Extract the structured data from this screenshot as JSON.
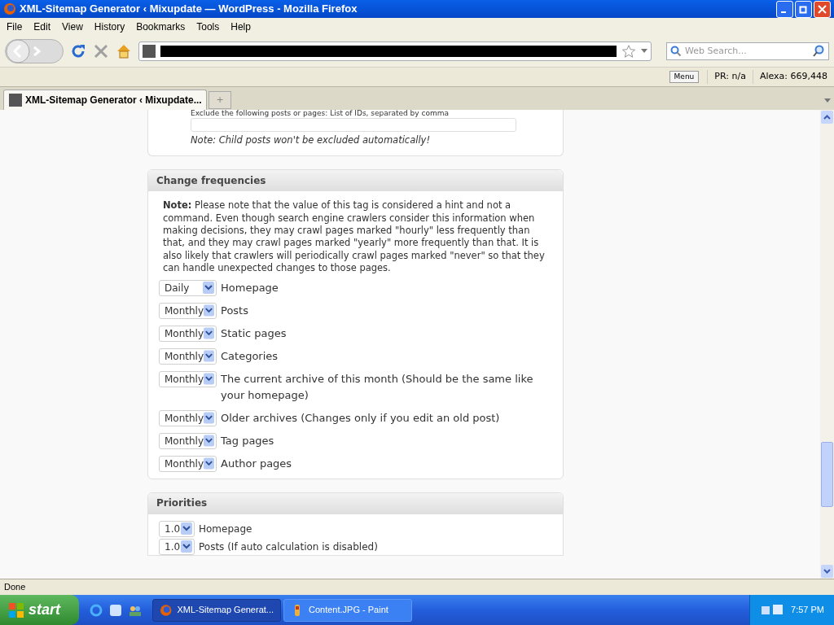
{
  "window": {
    "title": "XML-Sitemap Generator ‹ Mixupdate — WordPress - Mozilla Firefox"
  },
  "menu": [
    "File",
    "Edit",
    "View",
    "History",
    "Bookmarks",
    "Tools",
    "Help"
  ],
  "search": {
    "placeholder": "Web Search..."
  },
  "addon_bar": {
    "menu_button": "Menu",
    "pr": "PR: n/a",
    "alexa": "Alexa: 669,448"
  },
  "tabs": [
    {
      "label": "XML-Sitemap Generator ‹ Mixupdate...",
      "selected": true
    }
  ],
  "new_tab": "+",
  "exclude": {
    "label": "Exclude the following posts or pages: List of IDs, separated by comma",
    "note": "Note: Child posts won't be excluded automatically!"
  },
  "change_frequencies": {
    "title": "Change frequencies",
    "note": "**Note:** Please note that the value of this tag is considered a hint and not a command. Even though search engine crawlers consider this information when making decisions, they may crawl pages marked \"hourly\" less frequently than that, and they may crawl pages marked \"yearly\" more frequently than that. It is also likely that crawlers will periodically crawl pages marked \"never\" so that they can handle unexpected changes to those pages.",
    "rows": [
      {
        "value": "Daily",
        "label": "Homepage"
      },
      {
        "value": "Monthly",
        "label": "Posts"
      },
      {
        "value": "Monthly",
        "label": "Static pages"
      },
      {
        "value": "Monthly",
        "label": "Categories"
      },
      {
        "value": "Monthly",
        "label": "The current archive of this month (Should be the same like your homepage)"
      },
      {
        "value": "Monthly",
        "label": "Older archives (Changes only if you edit an old post)"
      },
      {
        "value": "Monthly",
        "label": "Tag pages"
      },
      {
        "value": "Monthly",
        "label": "Author pages"
      }
    ]
  },
  "priorities": {
    "title": "Priorities",
    "rows": [
      {
        "value": "1.0",
        "label": "Homepage"
      },
      {
        "value": "1.0",
        "label": "Posts (If auto calculation is disabled)"
      }
    ]
  },
  "status_bar": "Done",
  "taskbar": {
    "start": "start",
    "tasks": [
      {
        "label": "XML-Sitemap Generat...",
        "selected": true
      },
      {
        "label": "Content.JPG - Paint",
        "selected": false
      }
    ],
    "clock": "7:57 PM"
  }
}
